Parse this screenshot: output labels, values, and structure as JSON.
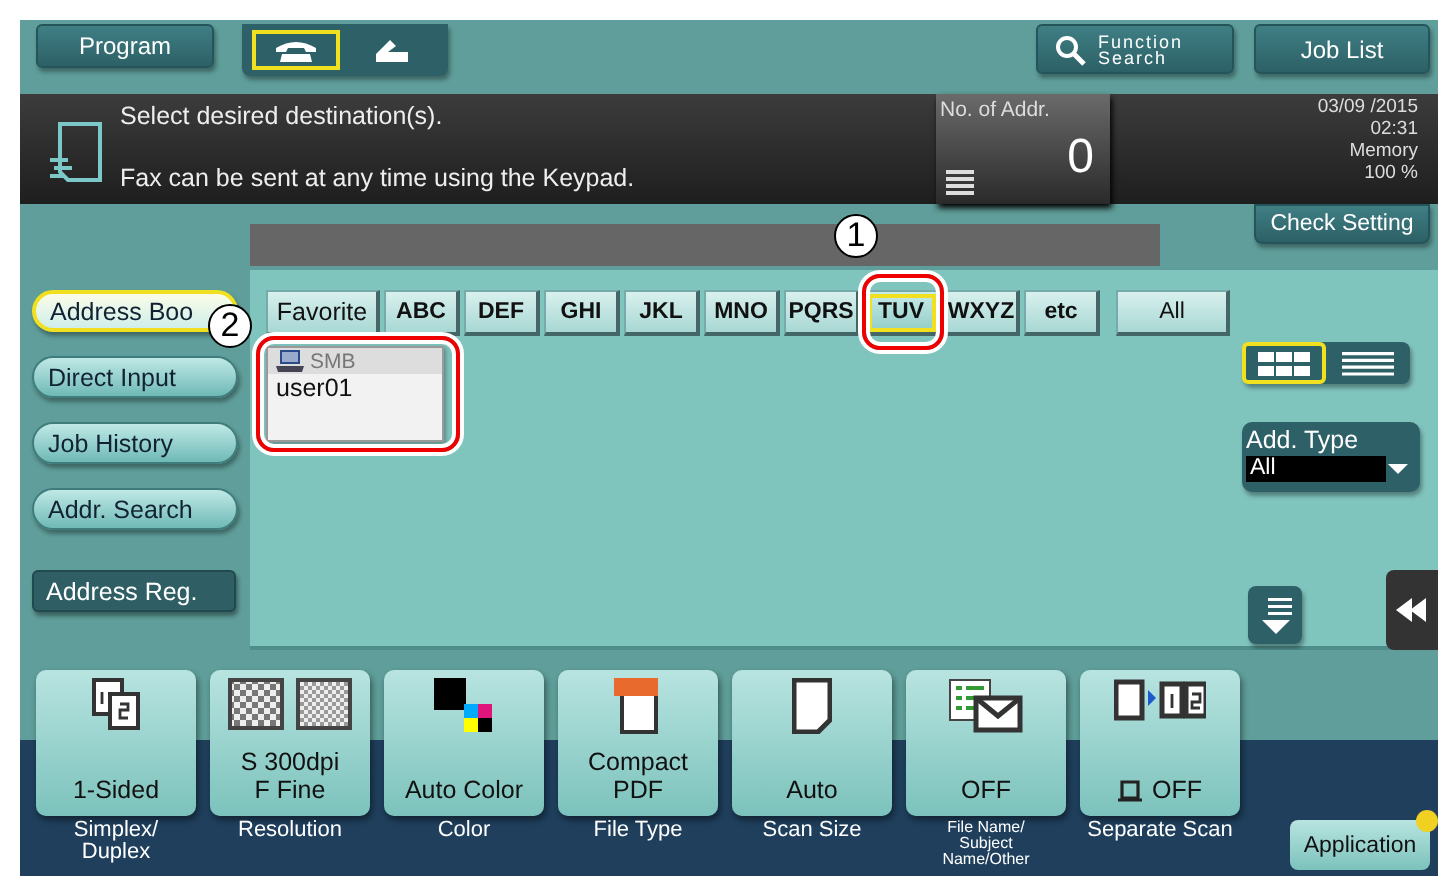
{
  "top_bar": {
    "program_button": "Program",
    "mode_tabs": [
      {
        "kind": "fax",
        "selected": true
      },
      {
        "kind": "phone",
        "selected": false
      }
    ],
    "function_search": [
      "Function",
      "Search"
    ],
    "job_list": "Job List"
  },
  "message": {
    "lines": [
      "Select desired destination(s).",
      "Fax can be sent at any time using the Keypad."
    ]
  },
  "address_count": {
    "label": "No. of Addr.",
    "value": "0"
  },
  "status": {
    "date": "03/09 /2015",
    "time": "02:31",
    "memory_label": "Memory",
    "memory_value": "100 %"
  },
  "check_setting": "Check Setting",
  "nav": [
    {
      "label": "Address Boo",
      "kind": "pill",
      "selected": true
    },
    {
      "label": "Direct Input",
      "kind": "pill",
      "selected": false
    },
    {
      "label": "Job History",
      "kind": "pill",
      "selected": false
    },
    {
      "label": "Addr. Search",
      "kind": "pill",
      "selected": false
    },
    {
      "label": "Address Reg.",
      "kind": "dark",
      "selected": false
    }
  ],
  "index_tabs": [
    {
      "label": "Favorite",
      "kind": "plain",
      "selected": false
    },
    {
      "label": "ABC",
      "kind": "letters",
      "selected": false
    },
    {
      "label": "DEF",
      "kind": "letters",
      "selected": false
    },
    {
      "label": "GHI",
      "kind": "letters",
      "selected": false
    },
    {
      "label": "JKL",
      "kind": "letters",
      "selected": false
    },
    {
      "label": "MNO",
      "kind": "letters",
      "selected": false
    },
    {
      "label": "PQRS",
      "kind": "letters",
      "selected": false
    },
    {
      "label": "TUV",
      "kind": "letters",
      "selected": true
    },
    {
      "label": "WXYZ",
      "kind": "letters",
      "selected": false
    },
    {
      "label": "etc",
      "kind": "letters",
      "selected": false
    },
    {
      "label": "All",
      "kind": "wide",
      "selected": false
    }
  ],
  "addresses": [
    {
      "type": "SMB",
      "name": "user01"
    }
  ],
  "view_modes": [
    {
      "kind": "grid",
      "selected": true
    },
    {
      "kind": "list",
      "selected": false
    }
  ],
  "add_type": {
    "label": "Add. Type",
    "value": "All"
  },
  "settings": [
    {
      "kind": "duplex",
      "value": "1-Sided",
      "label": "Simplex/\nDuplex"
    },
    {
      "kind": "resolution",
      "value": "S 300dpi\nF Fine",
      "label": "Resolution"
    },
    {
      "kind": "color",
      "value": "Auto Color",
      "label": "Color"
    },
    {
      "kind": "filetype",
      "value": "Compact\nPDF",
      "label": "File Type"
    },
    {
      "kind": "size",
      "value": "Auto",
      "label": "Scan Size"
    },
    {
      "kind": "filename",
      "value": "OFF",
      "label": "File Name/\nSubject\nName/Other"
    },
    {
      "kind": "separate",
      "value": "OFF",
      "label": "Separate Scan"
    }
  ],
  "application_button": "Application",
  "callouts": [
    {
      "number": "1"
    },
    {
      "number": "2"
    }
  ]
}
